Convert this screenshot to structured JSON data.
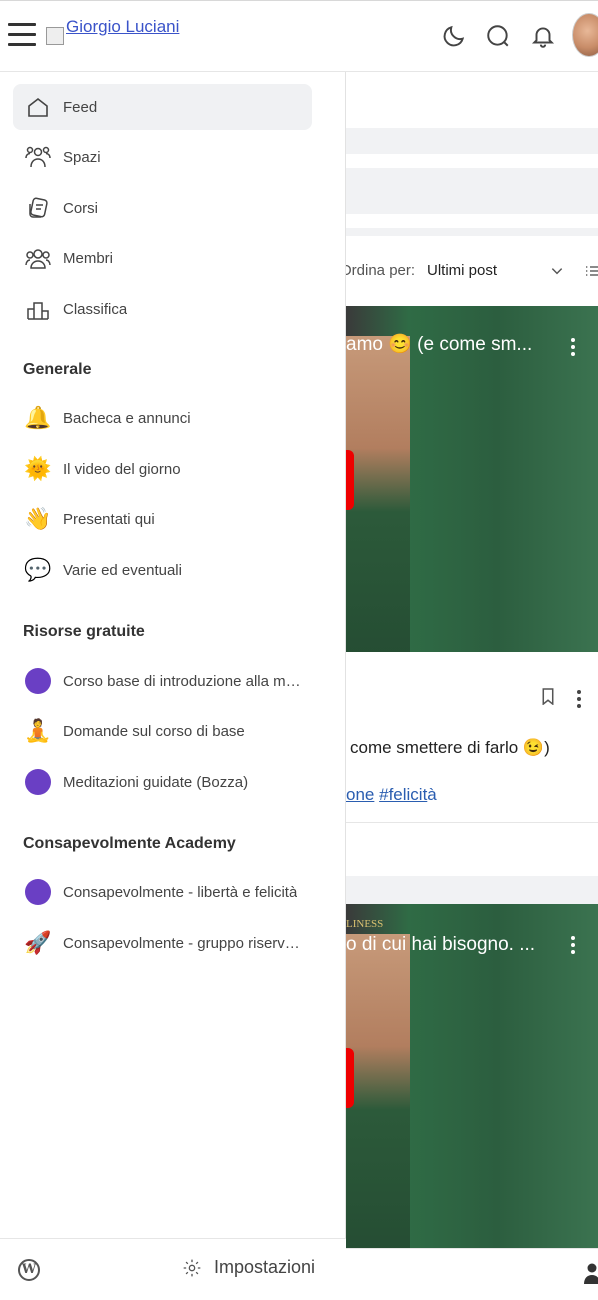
{
  "header": {
    "logo_alt": "Giorgio Luciani",
    "icons": [
      "menu-icon",
      "moon-icon",
      "search-icon",
      "bell-icon",
      "avatar"
    ]
  },
  "background": {
    "sort_label": "Ordina per:",
    "sort_value": "Ultimi post",
    "post1": {
      "video_title": "amo 😊 (e come sm...",
      "text": "come smettere di farlo 😉)",
      "tag1": "one",
      "tag2": "#felicit",
      "tag2_tail": "à"
    },
    "post2": {
      "video_title": "o di cui hai bisogno. ...",
      "overlay_text": "LINESS"
    }
  },
  "sidebar": {
    "main": [
      {
        "label": "Feed",
        "icon": "home-icon",
        "active": true
      },
      {
        "label": "Spazi",
        "icon": "spaces-icon"
      },
      {
        "label": "Corsi",
        "icon": "courses-icon"
      },
      {
        "label": "Membri",
        "icon": "members-icon"
      },
      {
        "label": "Classifica",
        "icon": "leaderboard-icon"
      }
    ],
    "sections": [
      {
        "title": "Generale",
        "items": [
          {
            "label": "Bacheca e annunci",
            "emoji": "🔔"
          },
          {
            "label": "Il video del giorno",
            "emoji": "🌞"
          },
          {
            "label": "Presentati qui",
            "emoji": "👋"
          },
          {
            "label": "Varie ed eventuali",
            "emoji": "💬"
          }
        ]
      },
      {
        "title": "Risorse gratuite",
        "items": [
          {
            "label": "Corso base di introduzione alla me...",
            "color": "#6a3fc4"
          },
          {
            "label": "Domande sul corso di base",
            "emoji": "🧘"
          },
          {
            "label": "Meditazioni guidate (Bozza)",
            "color": "#6a3fc4"
          }
        ]
      },
      {
        "title": "Consapevolmente Academy",
        "items": [
          {
            "label": "Consapevolmente - libertà e felicità",
            "color": "#6a3fc4"
          },
          {
            "label": "Consapevolmente - gruppo riservato",
            "emoji": "🚀"
          }
        ]
      }
    ],
    "footer": {
      "settings_label": "Impostazioni"
    }
  },
  "colors": {
    "accent_purple": "#6a3fc4",
    "active_bg": "#f0f1f3",
    "link_blue": "#2a5db0"
  }
}
